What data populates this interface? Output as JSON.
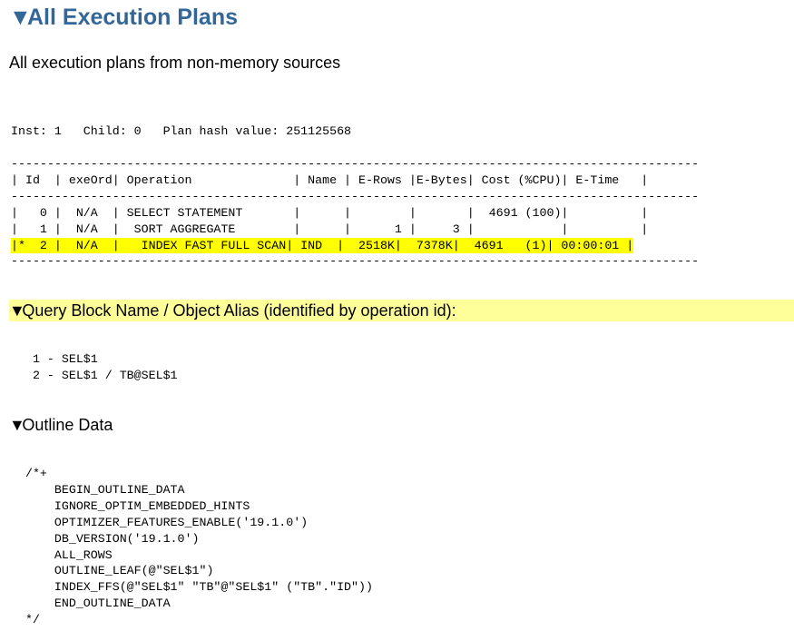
{
  "title": "All Execution Plans",
  "subtitle": "All execution plans from non-memory sources",
  "expanded_glyph": "▼",
  "plan_header": "Inst: 1   Child: 0   Plan hash value: 251125568",
  "plan_table": {
    "separator": "-----------------------------------------------------------------------------------------------",
    "header": "| Id  | exeOrd| Operation              | Name | E-Rows |E-Bytes| Cost (%CPU)| E-Time   |",
    "rows": [
      "|   0 |  N/A  | SELECT STATEMENT       |      |        |       |  4691 (100)|          |",
      "|   1 |  N/A  |  SORT AGGREGATE        |      |      1 |     3 |            |          |",
      "|*  2 |  N/A  |   INDEX FAST FULL SCAN| IND  |  2518K|  7378K|  4691   (1)| 00:00:01 |"
    ],
    "highlighted_row_index": 2,
    "highlight_color": "#ffff00"
  },
  "query_block": {
    "heading": "Query Block Name / Object Alias (identified by operation id):",
    "heading_bg": "#ffff99",
    "lines": [
      "   1 - SEL$1",
      "   2 - SEL$1 / TB@SEL$1"
    ]
  },
  "outline": {
    "heading": "Outline Data",
    "lines": [
      "  /*+",
      "      BEGIN_OUTLINE_DATA",
      "      IGNORE_OPTIM_EMBEDDED_HINTS",
      "      OPTIMIZER_FEATURES_ENABLE('19.1.0')",
      "      DB_VERSION('19.1.0')",
      "      ALL_ROWS",
      "      OUTLINE_LEAF(@\"SEL$1\")",
      "      INDEX_FFS(@\"SEL$1\" \"TB\"@\"SEL$1\" (\"TB\".\"ID\"))",
      "      END_OUTLINE_DATA",
      "  */"
    ]
  },
  "colors": {
    "title": "#336699"
  }
}
